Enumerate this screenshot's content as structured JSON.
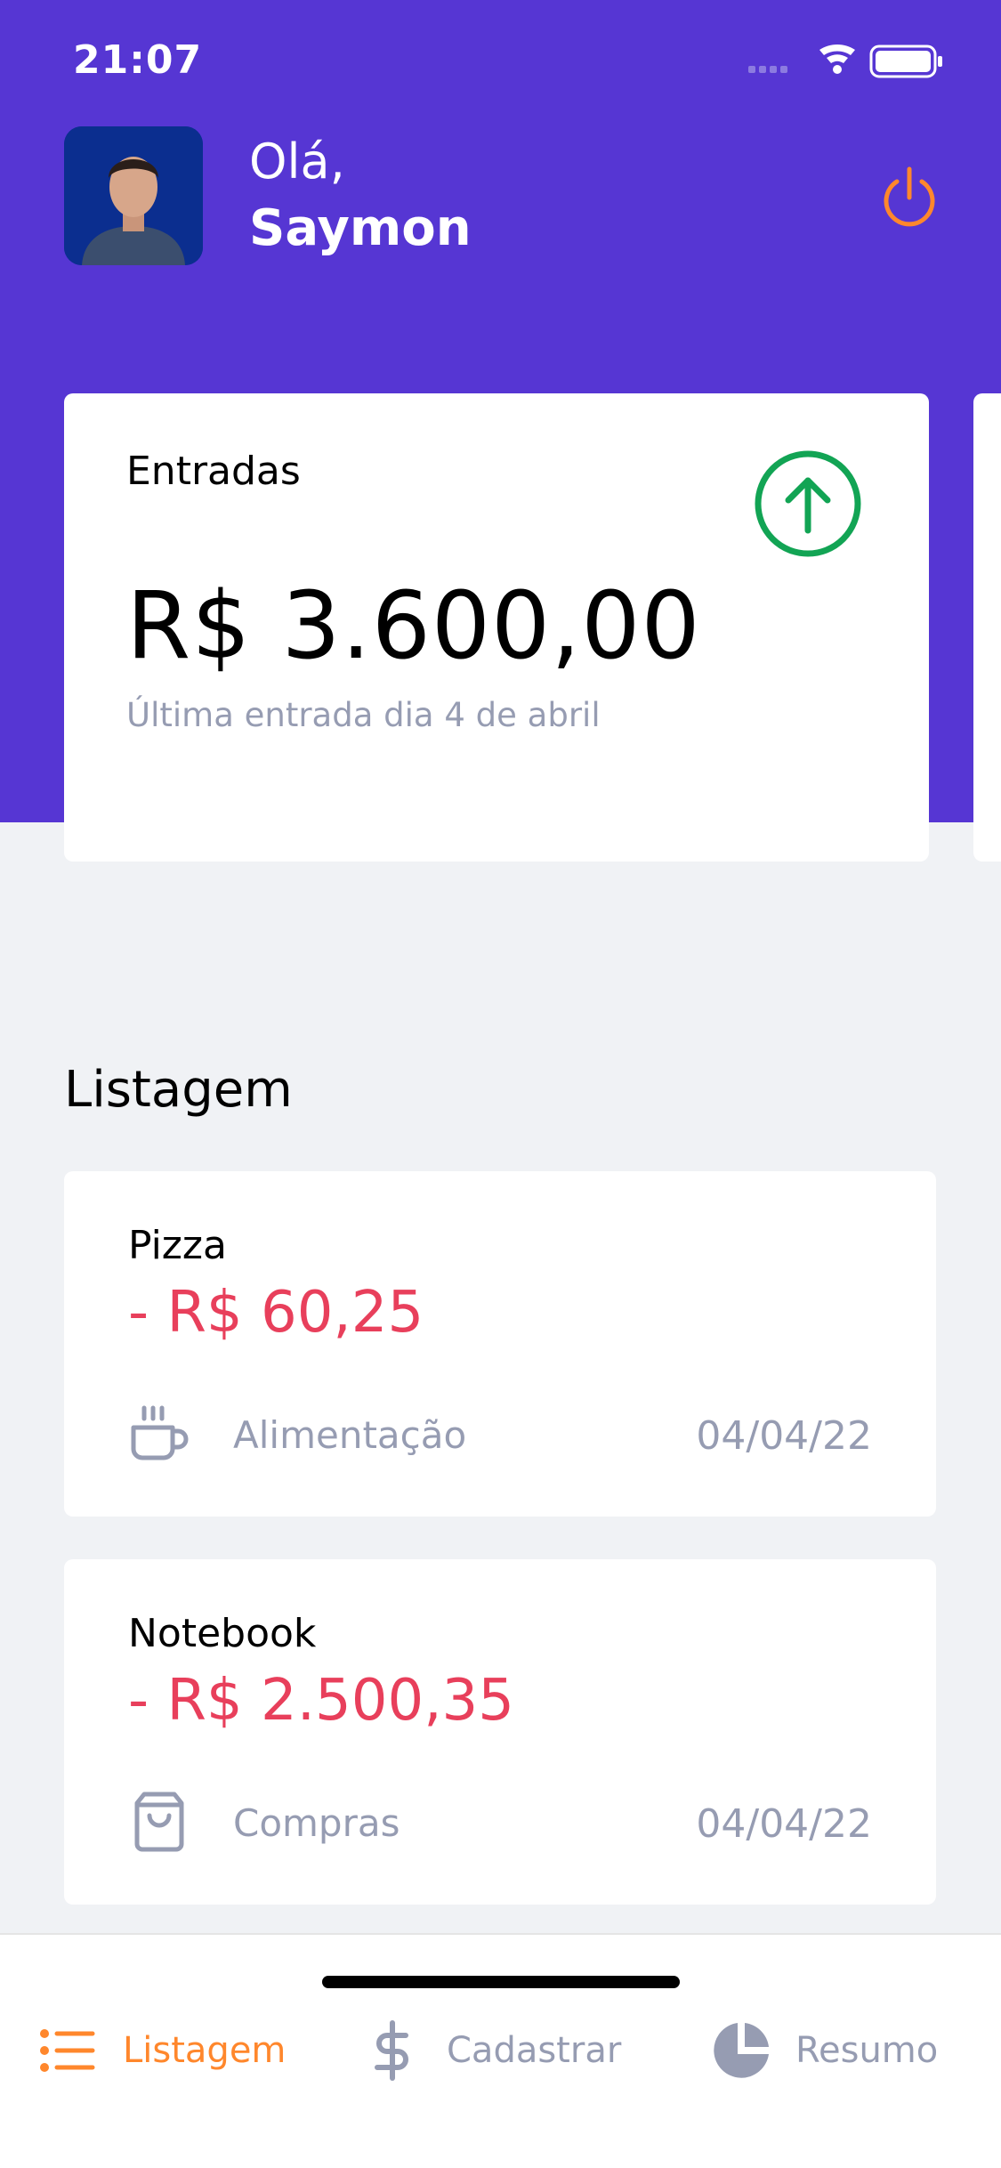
{
  "status_bar": {
    "time": "21:07"
  },
  "header": {
    "greeting": "Olá,",
    "user_name": "Saymon"
  },
  "highlight_card": {
    "title": "Entradas",
    "amount": "R$ 3.600,00",
    "last_transaction": "Última entrada dia 4 de abril",
    "icon": "arrow-up-circle-icon"
  },
  "listing": {
    "title": "Listagem",
    "transactions": [
      {
        "title": "Pizza",
        "amount": "- R$ 60,25",
        "category": "Alimentação",
        "category_icon": "coffee-icon",
        "date": "04/04/22"
      },
      {
        "title": "Notebook",
        "amount": "- R$ 2.500,35",
        "category": "Compras",
        "category_icon": "shopping-bag-icon",
        "date": "04/04/22"
      }
    ]
  },
  "tabs": [
    {
      "label": "Listagem",
      "icon": "list-icon",
      "active": true
    },
    {
      "label": "Cadastrar",
      "icon": "dollar-icon",
      "active": false
    },
    {
      "label": "Resumo",
      "icon": "pie-chart-icon",
      "active": false
    }
  ],
  "colors": {
    "primary": "#5636D3",
    "secondary": "#FF872C",
    "success": "#12A454",
    "attention": "#E83F5B",
    "text": "#969CB2",
    "background": "#F0F2F5"
  }
}
